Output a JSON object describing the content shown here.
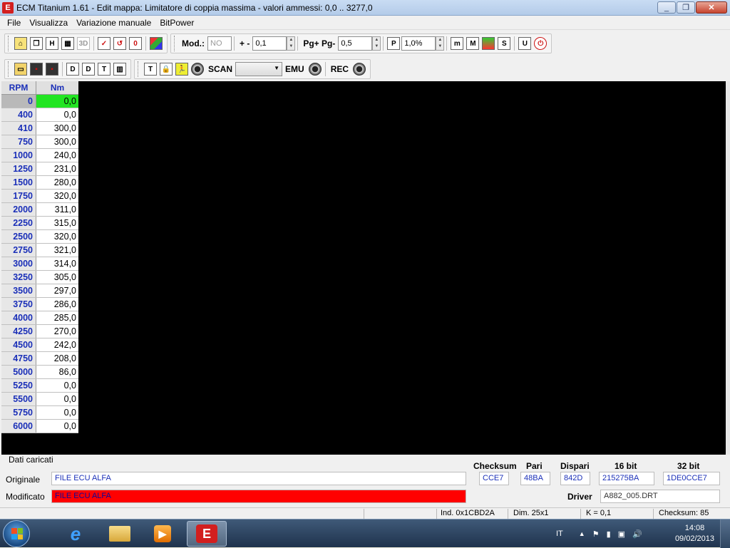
{
  "window": {
    "title": "ECM Titanium 1.61 - Edit mappa: Limitatore di coppia massima - valori ammessi: 0,0 .. 3277,0",
    "app_icon": "ecm-titanium-logo"
  },
  "menu": [
    "File",
    "Visualizza",
    "Variazione manuale",
    "BitPower"
  ],
  "toolbar1": {
    "mod_label": "Mod.:",
    "mod_value": "NO",
    "plusminus_label": "+ -",
    "step_value": "0,1",
    "pg_label": "Pg+ Pg-",
    "pg_value": "0,5",
    "percent_value": "1,0%",
    "icons": [
      "home-icon",
      "copy-icon",
      "table-icon",
      "chart-2d-icon",
      "chart-3d-icon",
      "check-icon",
      "undo-icon",
      "zero-icon",
      "color-icon",
      "p-icon",
      "m-small-icon",
      "m-large-icon",
      "palette-icon",
      "s-icon",
      "u-icon",
      "power-icon"
    ],
    "icon_glyphs": {
      "table": "H",
      "3d": "3D",
      "zero": "0",
      "p": "P",
      "m1": "m",
      "m2": "M",
      "s": "S",
      "u": "U"
    }
  },
  "toolbar2": {
    "scan_label": "SCAN",
    "scan_value": "",
    "emu_label": "EMU",
    "rec_label": "REC",
    "icon_glyphs": {
      "d1": "D",
      "d2": "D",
      "t1": "T",
      "t2": "T"
    }
  },
  "grid": {
    "col_rpm": "RPM",
    "col_nm": "Nm",
    "rows": [
      {
        "rpm": "0",
        "nm": "0,0"
      },
      {
        "rpm": "400",
        "nm": "0,0"
      },
      {
        "rpm": "410",
        "nm": "300,0"
      },
      {
        "rpm": "750",
        "nm": "300,0"
      },
      {
        "rpm": "1000",
        "nm": "240,0"
      },
      {
        "rpm": "1250",
        "nm": "231,0"
      },
      {
        "rpm": "1500",
        "nm": "280,0"
      },
      {
        "rpm": "1750",
        "nm": "320,0"
      },
      {
        "rpm": "2000",
        "nm": "311,0"
      },
      {
        "rpm": "2250",
        "nm": "315,0"
      },
      {
        "rpm": "2500",
        "nm": "320,0"
      },
      {
        "rpm": "2750",
        "nm": "321,0"
      },
      {
        "rpm": "3000",
        "nm": "314,0"
      },
      {
        "rpm": "3250",
        "nm": "305,0"
      },
      {
        "rpm": "3500",
        "nm": "297,0"
      },
      {
        "rpm": "3750",
        "nm": "286,0"
      },
      {
        "rpm": "4000",
        "nm": "285,0"
      },
      {
        "rpm": "4250",
        "nm": "270,0"
      },
      {
        "rpm": "4500",
        "nm": "242,0"
      },
      {
        "rpm": "4750",
        "nm": "208,0"
      },
      {
        "rpm": "5000",
        "nm": "86,0"
      },
      {
        "rpm": "5250",
        "nm": "0,0"
      },
      {
        "rpm": "5500",
        "nm": "0,0"
      },
      {
        "rpm": "5750",
        "nm": "0,0"
      },
      {
        "rpm": "6000",
        "nm": "0,0"
      }
    ]
  },
  "info": {
    "title": "Dati caricati",
    "originale_label": "Originale",
    "originale_value": "FILE ECU ALFA",
    "modificato_label": "Modificato",
    "modificato_value": "FILE ECU ALFA",
    "checksum_label": "Checksum",
    "checksum_value": "CCE7",
    "pari_label": "Pari",
    "pari_value": "48BA",
    "dispari_label": "Dispari",
    "dispari_value": "842D",
    "bit16_label": "16 bit",
    "bit16_value": "215275BA",
    "bit32_label": "32 bit",
    "bit32_value": "1DE0CCE7",
    "driver_label": "Driver",
    "driver_value": "A882_005.DRT"
  },
  "status": {
    "ind": "Ind. 0x1CBD2A",
    "dim": "Dim. 25x1",
    "k": "K = 0,1",
    "checksum": "Checksum: 85"
  },
  "taskbar": {
    "language": "IT",
    "time": "14:08",
    "date": "09/02/2013"
  }
}
